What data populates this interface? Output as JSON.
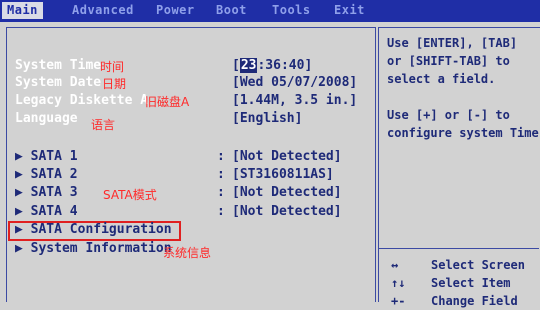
{
  "menu": {
    "tabs": [
      {
        "label": "Main",
        "active": true
      },
      {
        "label": "Advanced"
      },
      {
        "label": "Power"
      },
      {
        "label": "Boot"
      },
      {
        "label": "Tools"
      },
      {
        "label": "Exit"
      }
    ]
  },
  "settings": {
    "system_time": {
      "label": "System Time",
      "value_hl": "23",
      "value_rest": ":36:40]",
      "value_open": "[",
      "note": "时间"
    },
    "system_date": {
      "label": "System Date",
      "value": "[Wed 05/07/2008]",
      "note": "日期"
    },
    "legacy_diskette": {
      "label": "Legacy Diskette A",
      "value": "[1.44M, 3.5 in.]",
      "note": "旧磁盘A"
    },
    "language": {
      "label": "Language",
      "value": "[English]",
      "note": "语言"
    }
  },
  "sata": {
    "items": [
      {
        "label": "SATA 1",
        "value": "[Not Detected]"
      },
      {
        "label": "SATA 2",
        "value": "[ST3160811AS]"
      },
      {
        "label": "SATA 3",
        "value": "[Not Detected]"
      },
      {
        "label": "SATA 4",
        "value": "[Not Detected]"
      }
    ],
    "note": "SATA模式",
    "colon": ":"
  },
  "submenus": {
    "sata_config": {
      "label": "SATA Configuration"
    },
    "system_info": {
      "label": "System Information",
      "note": "系统信息"
    }
  },
  "arrow_glyph": "▶",
  "help": {
    "lines": [
      "Use [ENTER], [TAB]",
      "or [SHIFT-TAB] to",
      "select a field.",
      "",
      "Use [+] or [-] to",
      "configure system Time"
    ]
  },
  "keys": [
    {
      "key": "↔",
      "desc": "Select Screen"
    },
    {
      "key": "↑↓",
      "desc": "Select Item"
    },
    {
      "key": "+-",
      "desc": "Change Field"
    }
  ],
  "colors": {
    "menubar": "#1f2ea6",
    "text": "#1e2a78",
    "annotation": "#ff2a2a",
    "highlight_box": "#e02020"
  }
}
